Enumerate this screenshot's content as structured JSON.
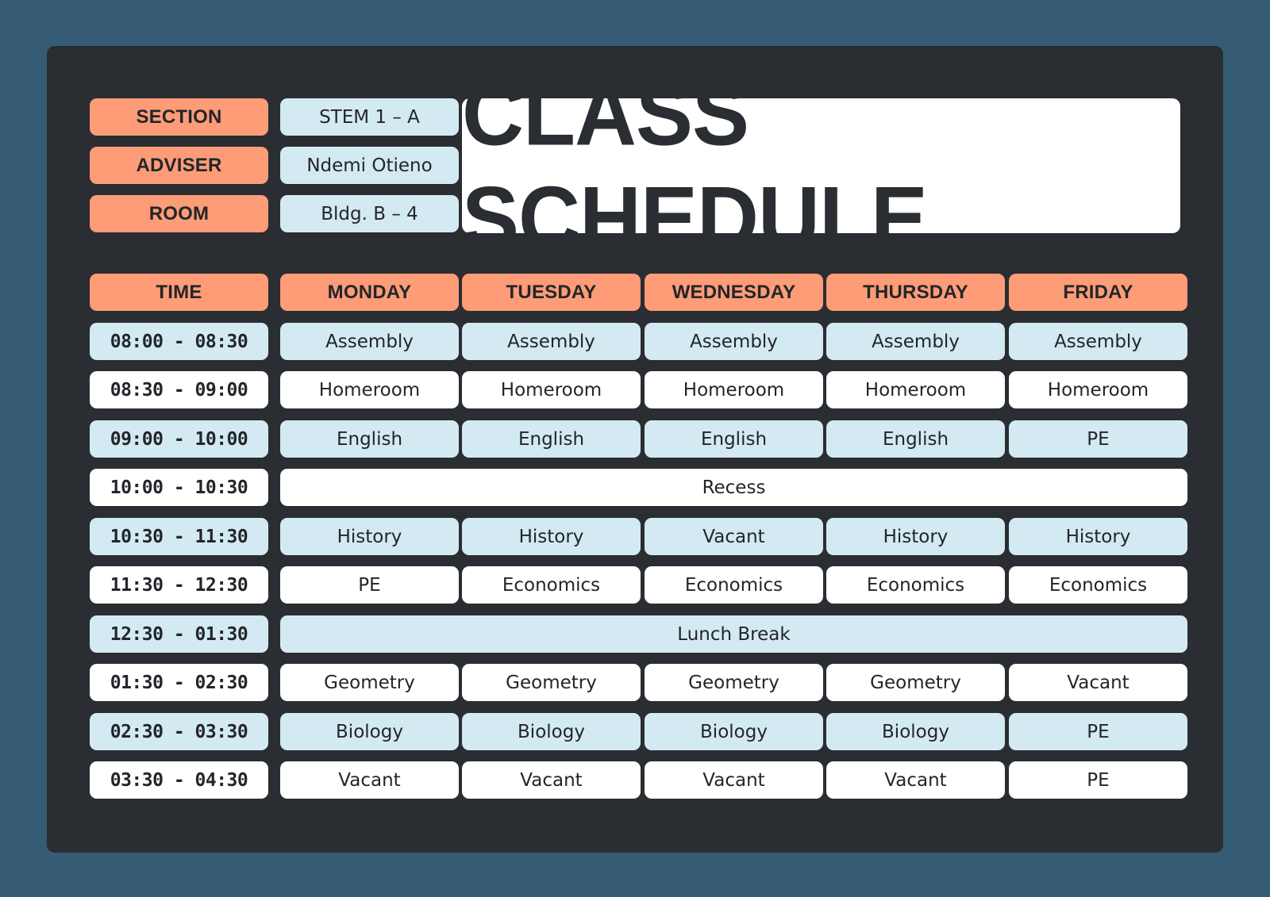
{
  "title": "CLASS SCHEDULE",
  "info": [
    {
      "label": "SECTION",
      "value": "STEM 1 – A"
    },
    {
      "label": "ADVISER",
      "value": "Ndemi Otieno"
    },
    {
      "label": "ROOM",
      "value": "Bldg. B – 4"
    }
  ],
  "headers": [
    "TIME",
    "MONDAY",
    "TUESDAY",
    "WEDNESDAY",
    "THURSDAY",
    "FRIDAY"
  ],
  "rows": [
    {
      "time": "08:00 - 08:30",
      "cells": [
        "Assembly",
        "Assembly",
        "Assembly",
        "Assembly",
        "Assembly"
      ]
    },
    {
      "time": "08:30 - 09:00",
      "cells": [
        "Homeroom",
        "Homeroom",
        "Homeroom",
        "Homeroom",
        "Homeroom"
      ]
    },
    {
      "time": "09:00 - 10:00",
      "cells": [
        "English",
        "English",
        "English",
        "English",
        "PE"
      ]
    },
    {
      "time": "10:00 - 10:30",
      "span": "Recess"
    },
    {
      "time": "10:30 - 11:30",
      "cells": [
        "History",
        "History",
        "Vacant",
        "History",
        "History"
      ]
    },
    {
      "time": "11:30 - 12:30",
      "cells": [
        "PE",
        "Economics",
        "Economics",
        "Economics",
        "Economics"
      ]
    },
    {
      "time": "12:30 - 01:30",
      "span": "Lunch Break"
    },
    {
      "time": "01:30 - 02:30",
      "cells": [
        "Geometry",
        "Geometry",
        "Geometry",
        "Geometry",
        "Vacant"
      ]
    },
    {
      "time": "02:30 - 03:30",
      "cells": [
        "Biology",
        "Biology",
        "Biology",
        "Biology",
        "PE"
      ]
    },
    {
      "time": "03:30 - 04:30",
      "cells": [
        "Vacant",
        "Vacant",
        "Vacant",
        "Vacant",
        "PE"
      ]
    }
  ],
  "colors": {
    "background": "#355c74",
    "panel": "#2a2d31",
    "header": "#fe9c78",
    "row_alt": "#d3eaf2",
    "row": "#ffffff"
  }
}
